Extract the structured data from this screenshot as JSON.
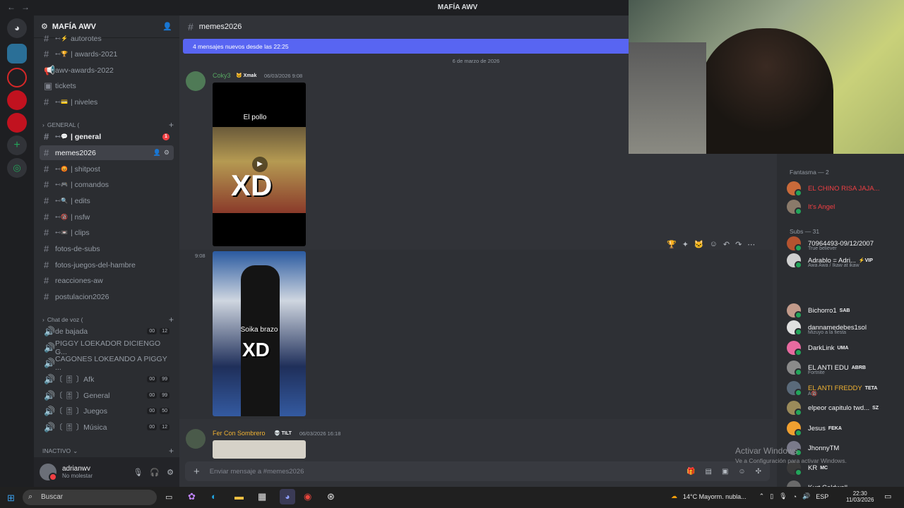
{
  "window": {
    "title": "MAFÍA AWV"
  },
  "guild": {
    "name": "MAFÍA AWV"
  },
  "channels": {
    "top": [
      {
        "label": "autorotes",
        "deco": "⊷⚡"
      },
      {
        "label": "| awards-2021",
        "deco": "⊷🏆"
      },
      {
        "label": "awv-awards-2022",
        "deco": ""
      },
      {
        "label": "tickets",
        "deco": ""
      },
      {
        "label": "| niveles",
        "deco": "⊷💳"
      }
    ],
    "cat_general": "GENERAL (",
    "general": [
      {
        "label": "| general",
        "deco": "⊷💬",
        "badge": "1"
      },
      {
        "label": "memes2026",
        "deco": ""
      },
      {
        "label": "| shitpost",
        "deco": "⊷😡"
      },
      {
        "label": "| comandos",
        "deco": "⊷🎮"
      },
      {
        "label": "| edits",
        "deco": "⊷🔍"
      },
      {
        "label": "| nsfw",
        "deco": "⊷🔞"
      },
      {
        "label": "| clips",
        "deco": "⊷📼"
      },
      {
        "label": "fotos-de-subs",
        "deco": ""
      },
      {
        "label": "fotos-juegos-del-hambre",
        "deco": ""
      },
      {
        "label": "reacciones-aw",
        "deco": ""
      },
      {
        "label": "postulacion2026",
        "deco": ""
      }
    ],
    "cat_voice": "Chat de voz (",
    "voice": [
      {
        "label": "de bajada",
        "p1": "00",
        "p2": "12"
      },
      {
        "label": "PIGGY LOEKADOR DICIENGO G...",
        "p1": "",
        "p2": ""
      },
      {
        "label": "CAGONES LOKEANDO A PIGGY ...",
        "p1": "",
        "p2": ""
      },
      {
        "label": "〔 🎚 〕Afk",
        "p1": "00",
        "p2": "99"
      },
      {
        "label": "〔 🎚 〕General",
        "p1": "00",
        "p2": "99"
      },
      {
        "label": "〔 🎚 〕Juegos",
        "p1": "00",
        "p2": "50"
      },
      {
        "label": "〔 🎚 〕Música",
        "p1": "00",
        "p2": "12"
      }
    ],
    "cat_inactive": "INACTIVO"
  },
  "user": {
    "name": "adrianwv",
    "status": "No molestar"
  },
  "chat": {
    "channel": "memes2026",
    "new_messages": "4 mensajes nuevos desde las 22:25",
    "date_divider": "6 de marzo de 2026",
    "messages": [
      {
        "author": "Coky3",
        "tag": "🐱 Xmak",
        "time": "06/03/2026 9:08",
        "video_caption": "El pollo",
        "overlay": "XD"
      },
      {
        "time_short": "9:08",
        "video_caption": "Soika brazo",
        "overlay": "XD"
      },
      {
        "author": "Fer Con Sombrero",
        "tag": "💀 TILT",
        "time": "06/03/2026 16:18"
      }
    ],
    "composer_placeholder": "Enviar mensaje a #memes2026"
  },
  "members": {
    "groups": [
      {
        "label": "Fantasma — 2"
      },
      {
        "label": "Subs — 31"
      }
    ],
    "list": [
      {
        "name": "EL CHINO RISA JAJA...",
        "color": "#f23f43",
        "status": "",
        "badge": "",
        "av": "#c96a3a"
      },
      {
        "name": "It's Angel",
        "color": "#f23f43",
        "status": "",
        "badge": "",
        "av": "#8a7a6a"
      },
      {
        "name": "70964493-09/12/2007",
        "color": "#f2f3f5",
        "status": "True believer",
        "badge": "",
        "av": "#b5532f"
      },
      {
        "name": "Adrablo = Adri...",
        "color": "#f2f3f5",
        "status": "Awa Awa / Ikaw at ikaw",
        "badge": "⚡VIP",
        "av": "#d0d0d0"
      },
      {
        "name": "Bichorro1",
        "color": "#f2f3f5",
        "status": "",
        "badge": "SAB",
        "av": "#c29a8a"
      },
      {
        "name": "dannamedebes1sol",
        "color": "#f2f3f5",
        "status": "Mizuyo a la fiesta",
        "badge": "",
        "av": "#e0e0e0"
      },
      {
        "name": "DarkLink",
        "color": "#f2f3f5",
        "status": "",
        "badge": "UMA",
        "av": "#e86aa0"
      },
      {
        "name": "EL ANTI EDU",
        "color": "#f2f3f5",
        "status": "Fortnite",
        "badge": "ABRB",
        "av": "#8a8a8a"
      },
      {
        "name": "EL ANTI FREDDY",
        "color": "#f0b232",
        "status": "A🔞",
        "badge": "TETA",
        "av": "#5a6a7a"
      },
      {
        "name": "elpeor capitulo twd...",
        "color": "#f2f3f5",
        "status": "",
        "badge": "SZ",
        "av": "#9a8a5a"
      },
      {
        "name": "Jesus",
        "color": "#f2f3f5",
        "status": "",
        "badge": "FEKA",
        "av": "#f0a030"
      },
      {
        "name": "JhonnyTM",
        "color": "#f2f3f5",
        "status": "",
        "badge": "",
        "av": "#7a7a8a"
      },
      {
        "name": "KR",
        "color": "#f2f3f5",
        "status": "",
        "badge": "MC",
        "av": "#3a3a3a"
      },
      {
        "name": "Kurt Caldwell",
        "color": "#f2f3f5",
        "status": "",
        "badge": "",
        "av": "#6a6a6a"
      }
    ]
  },
  "overlay": {
    "activate": "Activar Windows",
    "activate_sub": "Ve a Configuración para activar Windows."
  },
  "taskbar": {
    "search": "Buscar",
    "weather": "14°C  Mayorm. nubla...",
    "lang": "ESP",
    "time": "22:30",
    "date": "11/03/2026"
  }
}
